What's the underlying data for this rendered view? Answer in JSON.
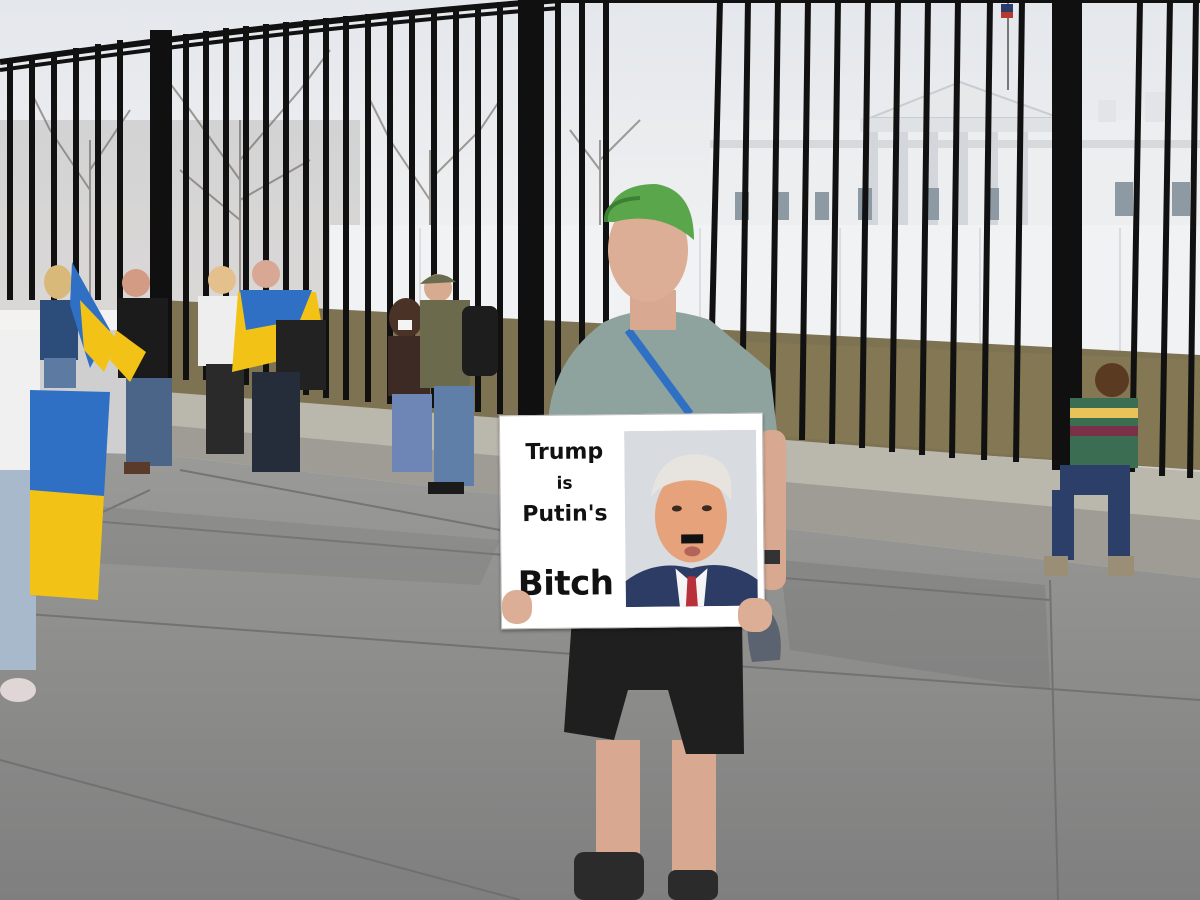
{
  "scene": {
    "subject": "protester-with-sign",
    "colors": {
      "sky": "#e9ebee",
      "fence": "#141414",
      "building": "#eef0f2",
      "wall": "#f2f3f4",
      "lawn": "#7c7351",
      "pavement": "#8c8c8c",
      "ledge": "#b9b6ab",
      "flag_blue": "#2f6fc4",
      "flag_yellow": "#f2c316",
      "cap_green": "#5aa64a",
      "shirt": "#8ea39e",
      "shorts": "#1f1f1f"
    }
  },
  "sign": {
    "line1": "Trump",
    "line2": "is",
    "line3": "Putin's",
    "line4": "Bitch",
    "photo": "portrait-icon"
  }
}
